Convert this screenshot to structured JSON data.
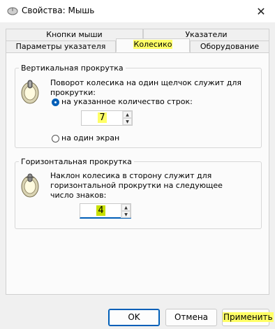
{
  "window": {
    "title": "Свойства: Мышь",
    "close_symbol": "✕"
  },
  "tabs": {
    "row1": [
      {
        "label": "Кнопки мыши",
        "selected": false
      },
      {
        "label": "Указатели",
        "selected": false
      }
    ],
    "row2": [
      {
        "label": "Параметры указателя",
        "selected": false
      },
      {
        "label": "Колесико",
        "selected": true
      },
      {
        "label": "Оборудование",
        "selected": false
      }
    ]
  },
  "vertical_scroll": {
    "legend": "Вертикальная прокрутка",
    "icon": "mouse-wheel-vertical-icon",
    "description": "Поворот колесика на один щелчок служит для прокрутки:",
    "option_lines": {
      "label": "на указанное количество строк:",
      "checked": true
    },
    "lines_value": "7",
    "option_screen": {
      "label": "на один экран",
      "checked": false
    }
  },
  "horizontal_scroll": {
    "legend": "Горизонтальная прокрутка",
    "icon": "mouse-wheel-horizontal-icon",
    "description_line1": "Наклон колесика в сторону служит для",
    "description_line2": "горизонтальной прокрутки на следующее",
    "description_line3": "число знаков:",
    "chars_value": "4"
  },
  "buttons": {
    "ok": "OK",
    "cancel": "Отмена",
    "apply": "Применить"
  },
  "colors": {
    "accent": "#005fb8",
    "highlight": "#ffff66",
    "background": "#f0f0f0"
  }
}
